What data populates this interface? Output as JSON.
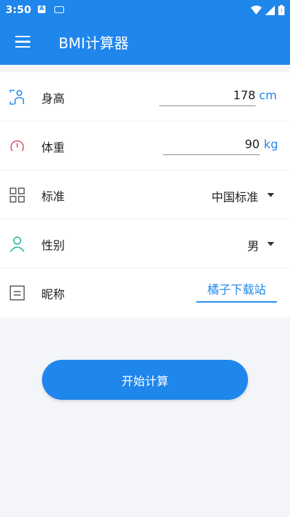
{
  "status": {
    "time": "3:50",
    "a_badge": "A",
    "battery_glyph": "!"
  },
  "appbar": {
    "title": "BMI计算器"
  },
  "form": {
    "height": {
      "label": "身高",
      "value": "178",
      "unit": "cm"
    },
    "weight": {
      "label": "体重",
      "value": "90",
      "unit": "kg"
    },
    "standard": {
      "label": "标准",
      "selected": "中国标准"
    },
    "gender": {
      "label": "性别",
      "selected": "男"
    },
    "nickname": {
      "label": "昵称",
      "value": "橘子下载站"
    }
  },
  "actions": {
    "calculate_label": "开始计算"
  },
  "colors": {
    "primary": "#1f86ec",
    "weight_icon": "#e0475c",
    "gender_icon": "#1ab29b"
  }
}
